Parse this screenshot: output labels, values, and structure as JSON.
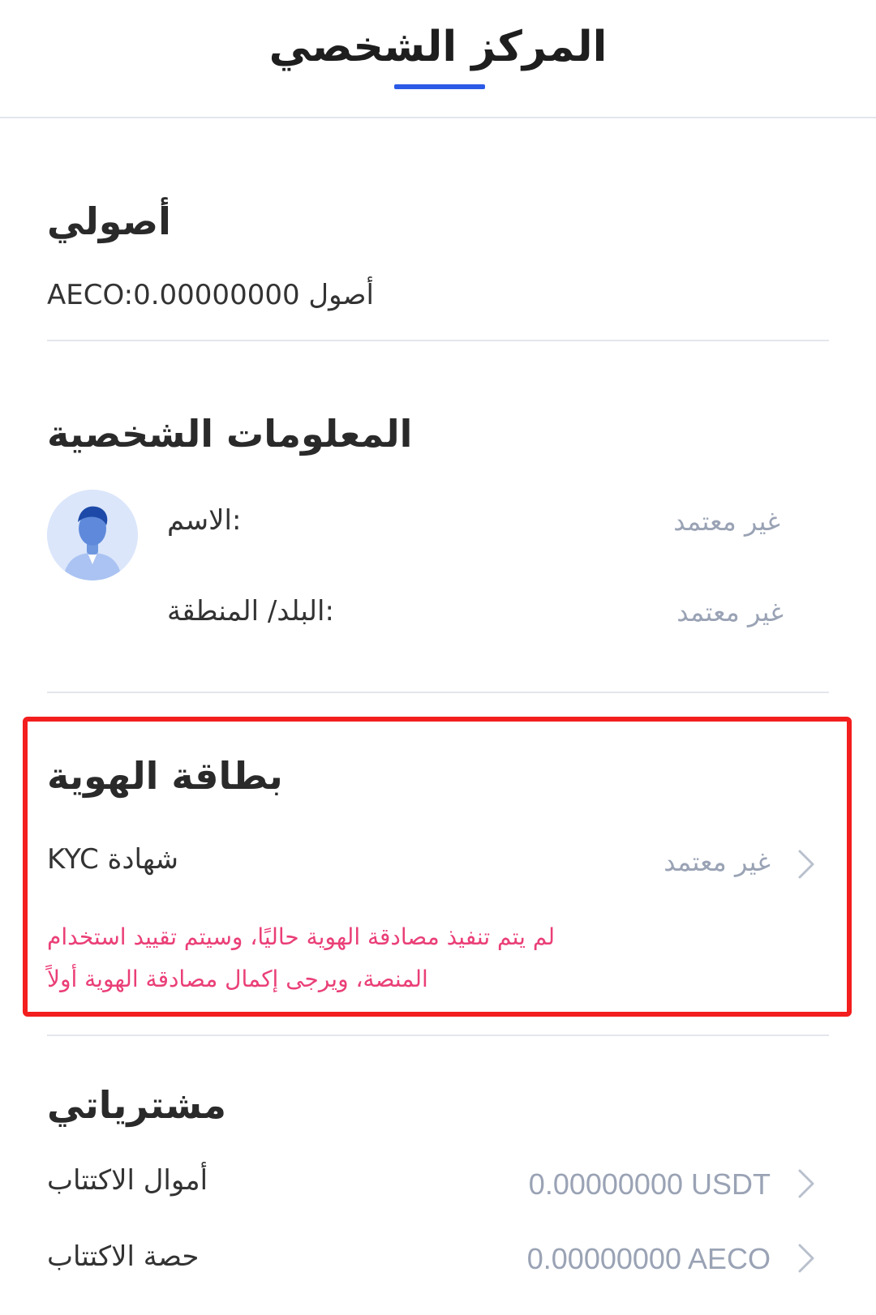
{
  "header": {
    "title": "المركز الشخصي"
  },
  "assets": {
    "title": "أصولي",
    "balance_text": "أصول AECO:0.00000000"
  },
  "personal_info": {
    "title": "المعلومات الشخصية",
    "name_label": ":الاسم",
    "name_value": "غير معتمد",
    "region_label": ":البلد/ المنطقة",
    "region_value": "غير معتمد"
  },
  "id_card": {
    "title": "بطاقة الهوية",
    "kyc_label": "شهادة KYC",
    "kyc_value": "غير معتمد",
    "warning_line1": "لم يتم تنفيذ مصادقة الهوية حاليًا، وسيتم تقييد استخدام",
    "warning_line2": "المنصة، ويرجى إكمال مصادقة الهوية أولاً"
  },
  "purchases": {
    "title": "مشترياتي",
    "funds_label": "أموال الاكتتاب",
    "funds_value": "0.00000000 USDT",
    "share_label": "حصة الاكتتاب",
    "share_value": "0.00000000 AECO"
  },
  "colors": {
    "accent": "#2b5ae6",
    "highlight_border": "#f31e1e",
    "warning_text": "#ea3f77",
    "muted_text": "#9aa3b5"
  }
}
